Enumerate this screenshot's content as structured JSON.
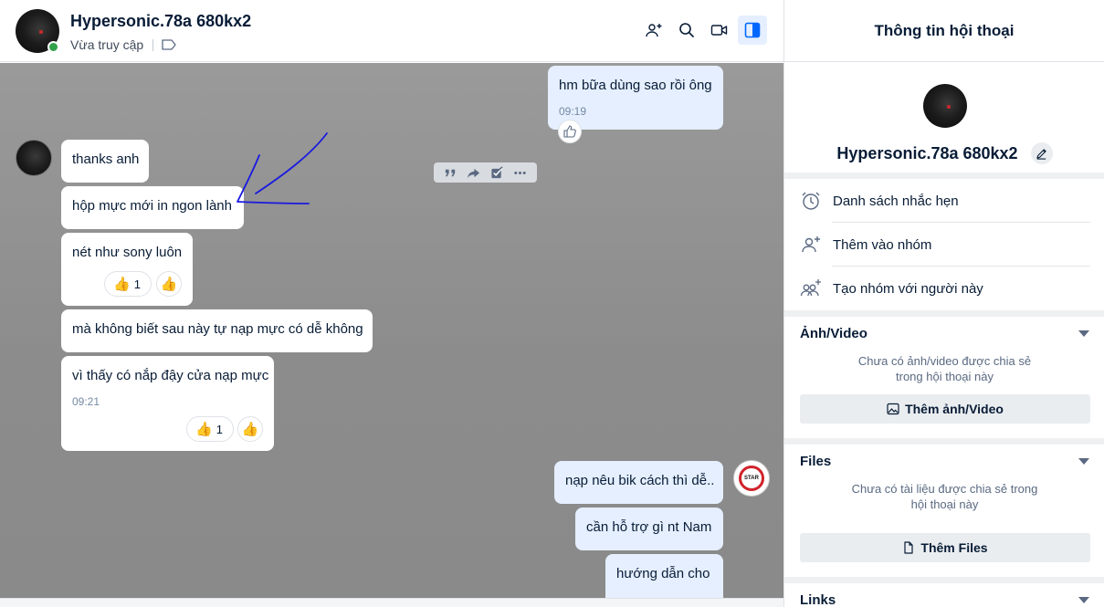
{
  "chat": {
    "name": "Hypersonic.78a 680kx2",
    "status": "Vừa truy cập"
  },
  "header_icons": [
    "add-to-group-icon",
    "search-icon",
    "video-call-icon",
    "toggle-info-panel-icon"
  ],
  "messages": {
    "m1": {
      "text": "hm bữa dùng sao rồi ông",
      "time": "09:19"
    },
    "m2": {
      "text": "thanks anh"
    },
    "m3": {
      "text": "hộp mực mới in ngon lành"
    },
    "m4": {
      "text": "nét như sony luôn",
      "reaction_count": "1"
    },
    "m5": {
      "text": "mà không biết sau này tự nạp mực có dễ không"
    },
    "m6": {
      "text": "vì thấy có nắp đậy cửa nạp mực",
      "time": "09:21",
      "reaction_count": "1"
    },
    "m7": {
      "text": "nạp nêu bik cách thì dễ.."
    },
    "m8": {
      "text": "cần hỗ trợ gì nt Nam"
    },
    "m9": {
      "text": "hướng dẫn  cho"
    }
  },
  "brand_avatar_text": "STAR",
  "info_panel": {
    "title": "Thông tin hội thoại",
    "profile_name": "Hypersonic.78a 680kx2",
    "options": [
      {
        "label": "Danh sách nhắc hẹn"
      },
      {
        "label": "Thêm vào nhóm"
      },
      {
        "label": "Tạo nhóm với người này"
      }
    ],
    "media": {
      "title": "Ảnh/Video",
      "empty_line1": "Chưa có ảnh/video được chia sẻ",
      "empty_line2": "trong hội thoại này",
      "button": "Thêm ảnh/Video"
    },
    "files": {
      "title": "Files",
      "empty_line1": "Chưa có tài liệu được chia sẻ trong",
      "empty_line2": "hội thoại này",
      "button": "Thêm Files"
    },
    "links": {
      "title": "Links"
    }
  },
  "colors": {
    "accent": "#0068ff",
    "my_bubble": "#e5efff",
    "chat_bg": "#8f8f8f",
    "annotation": "#1a1adf"
  }
}
